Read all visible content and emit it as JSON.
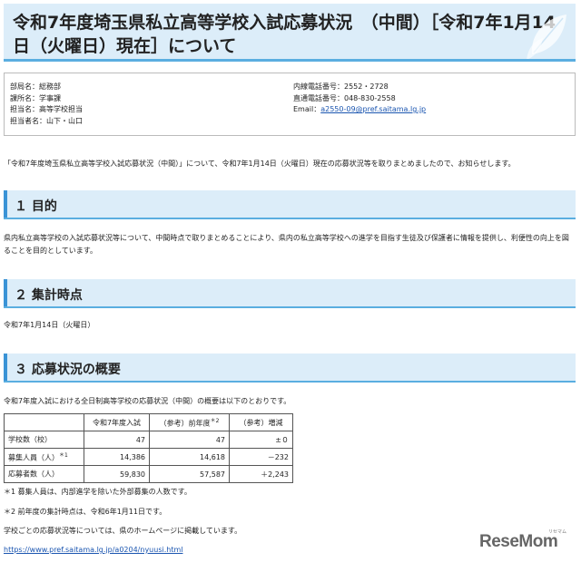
{
  "page_title": "令和7年度埼玉県私立高等学校入試応募状況　（中間）［令和7年1月14日（火曜日）現在］について",
  "contact": {
    "department": "部局名：総務部",
    "section": "課所名：学事課",
    "charge": "担当名：高等学校担当",
    "person": "担当者名：山下・山口",
    "ext_phone": "内線電話番号：2552・2728",
    "direct_phone": "直通電話番号：048-830-2558",
    "email_label": "Email：",
    "email": "a2550-09@pref.saitama.lg.jp"
  },
  "intro": "「令和7年度埼玉県私立高等学校入試応募状況（中間）」について、令和7年1月14日（火曜日）現在の応募状況等を取りまとめましたので、お知らせします。",
  "sections": [
    {
      "heading": "１ 目的",
      "body": "県内私立高等学校の入試応募状況等について、中間時点で取りまとめることにより、県内の私立高等学校への進学を目指す生徒及び保護者に情報を提供し、利便性の向上を図ることを目的としています。"
    },
    {
      "heading": "２ 集計時点",
      "body": "令和7年1月14日（火曜日）"
    },
    {
      "heading": "３ 応募状況の概要",
      "body": "令和7年度入試における全日制高等学校の応募状況（中間）の概要は以下のとおりです。"
    }
  ],
  "table": {
    "headers": [
      "",
      "令和7年度入試",
      "（参考）前年度",
      "（参考）増減"
    ],
    "header_sup": "＊2",
    "rows": [
      {
        "label": "学校数（校）",
        "sup": "",
        "values": [
          "47",
          "47",
          "±０"
        ]
      },
      {
        "label": "募集人員（人）",
        "sup": "＊1",
        "values": [
          "14,386",
          "14,618",
          "－232"
        ]
      },
      {
        "label": "応募者数（人）",
        "sup": "",
        "values": [
          "59,830",
          "57,587",
          "＋2,243"
        ]
      }
    ]
  },
  "notes": [
    "＊1 募集人員は、内部進学を除いた外部募集の人数です。",
    "＊2 前年度の集計時点は、令和6年1月11日です。",
    "学校ごとの応募状況等については、県のホームページに掲載しています。"
  ],
  "link_url": "https://www.pref.saitama.lg.jp/a0204/nyuusi.html",
  "watermark": {
    "brand": "ReseMom",
    "sub": "リセマム"
  },
  "colors": {
    "accent": "#3a93d6",
    "header_bg": "#dcedf9",
    "link": "#1a55b0"
  }
}
